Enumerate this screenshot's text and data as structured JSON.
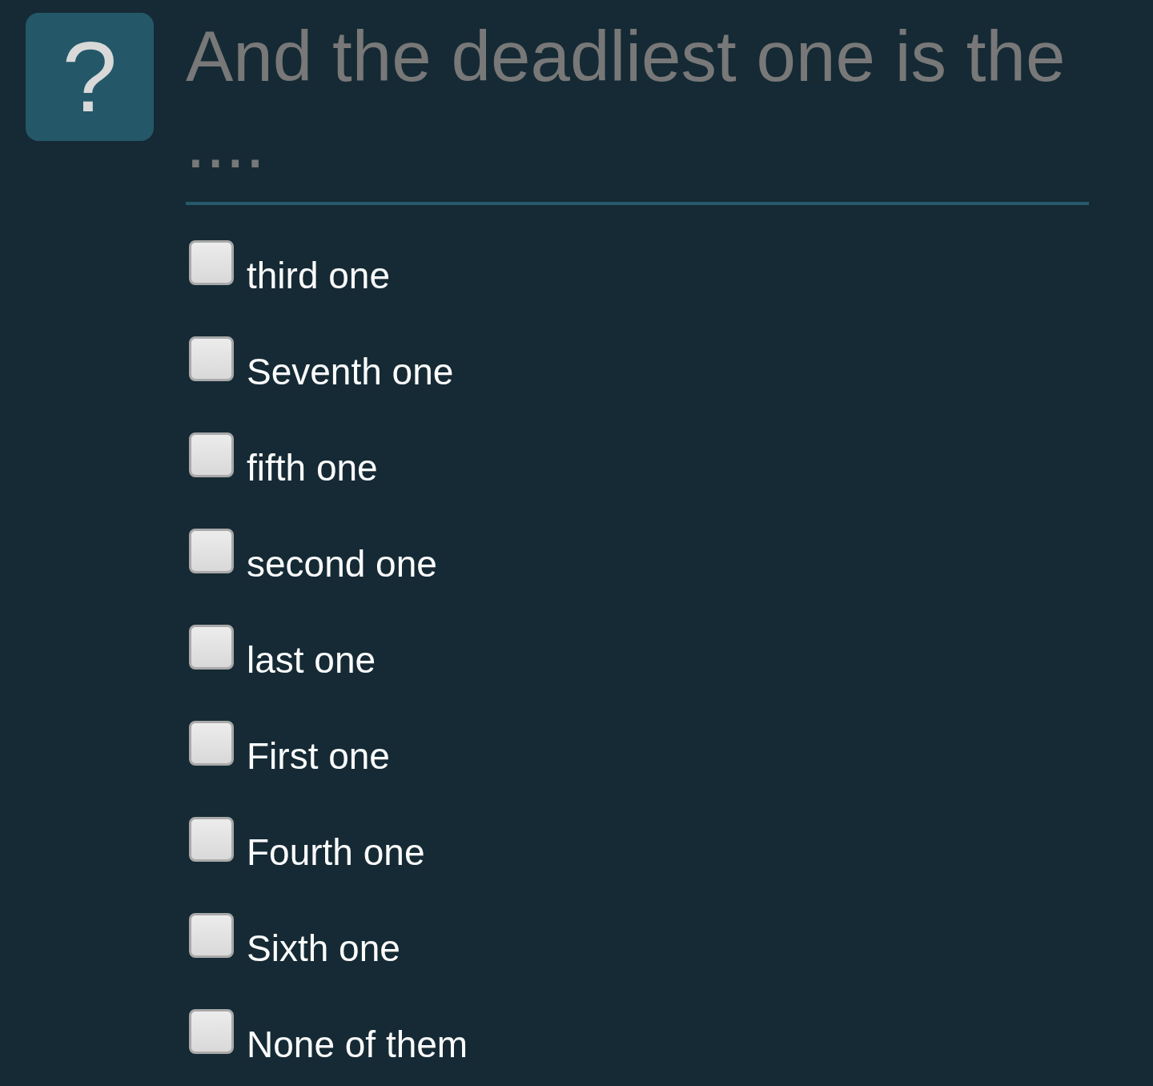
{
  "question": {
    "icon": "?",
    "title": "And the deadliest one is the ...."
  },
  "options": [
    {
      "label": "third one",
      "checked": false
    },
    {
      "label": "Seventh one",
      "checked": false
    },
    {
      "label": "fifth one",
      "checked": false
    },
    {
      "label": "second one",
      "checked": false
    },
    {
      "label": "last one",
      "checked": false
    },
    {
      "label": "First one",
      "checked": false
    },
    {
      "label": "Fourth one",
      "checked": false
    },
    {
      "label": "Sixth one",
      "checked": false
    },
    {
      "label": "None of them",
      "checked": false
    }
  ]
}
